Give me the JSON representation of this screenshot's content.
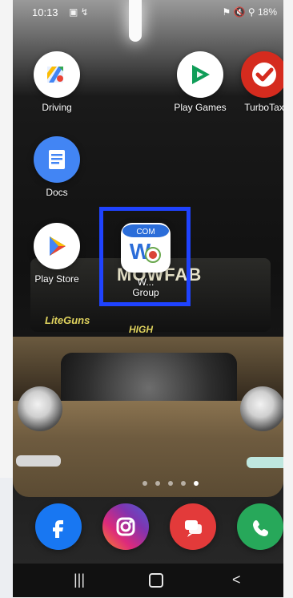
{
  "status_bar": {
    "time": "10:13",
    "left_icons": "▣ ↯",
    "right_status": "⚑ 🔇 ⚲ 18%"
  },
  "wallpaper": {
    "banner_text": "MOWFAB",
    "banner_script_left": "LiteGuns",
    "banner_script_right": "HIGH"
  },
  "apps": {
    "driving": {
      "label": "Driving",
      "icon": "maps-driving-icon"
    },
    "play_games": {
      "label": "Play Games",
      "icon": "play-games-icon"
    },
    "turbotax": {
      "label": "TurboTax",
      "icon": "turbotax-icon"
    },
    "docs": {
      "label": "Docs",
      "icon": "docs-icon"
    },
    "play_store": {
      "label": "Play Store",
      "icon": "play-store-icon"
    },
    "w_group": {
      "badge": "COM",
      "label_line1": "W...",
      "label_line2": "Group",
      "icon": "w-group-app-icon"
    }
  },
  "page_indicator": {
    "count": 5,
    "active_index": 4
  },
  "dock": {
    "facebook": {
      "icon": "facebook-icon"
    },
    "instagram": {
      "icon": "instagram-icon"
    },
    "messages": {
      "icon": "message-icon"
    },
    "phone": {
      "icon": "phone-icon"
    }
  },
  "nav": {
    "recents": "|||",
    "back": "<"
  },
  "colors": {
    "selection": "#1f43ff",
    "facebook": "#1877f2",
    "phone": "#27a85a",
    "messages": "#e33a3a"
  }
}
